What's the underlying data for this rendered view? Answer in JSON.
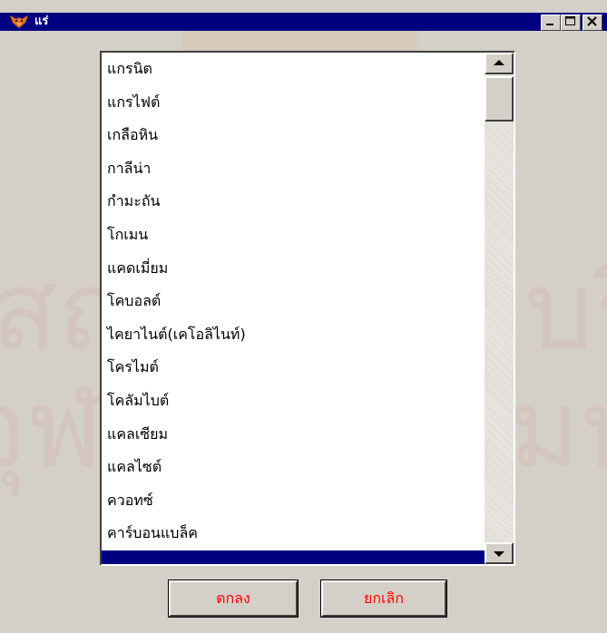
{
  "window": {
    "title": "แร่",
    "icon": "fox-head-icon",
    "min_glyph": "_",
    "max_glyph": "□",
    "close_glyph": "✕"
  },
  "watermark_text": {
    "line1": "สถาบันวิทยบริการ",
    "line2": "จุฬาลงกรณ์มหาวิทยาลัย"
  },
  "list": {
    "items": [
      "แกรนิต",
      "แกรไฟต์",
      "เกลือหิน",
      "กาลีน่า",
      "กำมะถัน",
      "โกเมน",
      "แคดเมี่ยม",
      "โคบอลต์",
      "ไคยาไนต์(เคโอลิไนท์)",
      "โครไมต์",
      "โคลัมไบต์",
      "แคลเซียม",
      "แคลไซต์",
      "ควอทซ์",
      "คาร์บอนแบล็ค"
    ],
    "selected_partial": ""
  },
  "buttons": {
    "ok_label": "ตกลง",
    "cancel_label": "ยกเลิก"
  },
  "colors": {
    "titlebar": "#000080",
    "dialog_bg": "#d4d0c8",
    "button_text": "#ff0000"
  }
}
